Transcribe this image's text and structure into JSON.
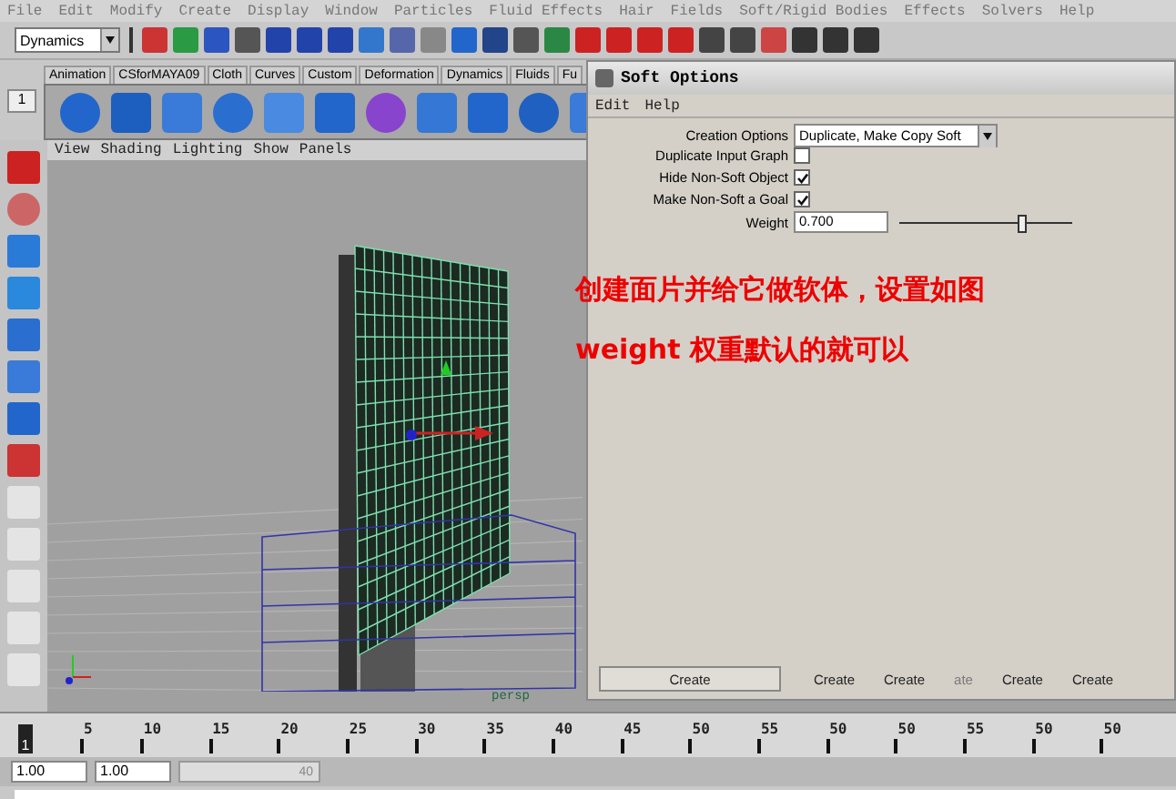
{
  "menu_bar": [
    "File",
    "Edit",
    "Modify",
    "Create",
    "Display",
    "Window",
    "Particles",
    "Fluid Effects",
    "Hair",
    "Fields",
    "Soft/Rigid Bodies",
    "Effects",
    "Solvers",
    "Help"
  ],
  "status_line": {
    "mode": "Dynamics"
  },
  "shelf": {
    "row_number": "1",
    "tabs": [
      "Animation",
      "CSforMAYA09",
      "Cloth",
      "Curves",
      "Custom",
      "Deformation",
      "Dynamics",
      "Fluids",
      "Fu"
    ]
  },
  "viewport": {
    "menu": [
      "View",
      "Shading",
      "Lighting",
      "Show",
      "Panels"
    ],
    "camera_label": "persp"
  },
  "annotation": [
    "创建面片并给它做软体，设置如图",
    "weight 权重默认的就可以"
  ],
  "soft_options": {
    "title": "Soft Options",
    "menu": [
      "Edit",
      "Help"
    ],
    "creation_options": {
      "label": "Creation Options",
      "value": "Duplicate, Make Copy Soft"
    },
    "checkboxes": [
      {
        "label": "Duplicate Input Graph",
        "checked": false
      },
      {
        "label": "Hide Non-Soft Object",
        "checked": true
      },
      {
        "label": "Make Non-Soft a Goal",
        "checked": true
      }
    ],
    "weight": {
      "label": "Weight",
      "value": "0.700",
      "level": 0.68
    },
    "buttons": [
      {
        "label": "Create",
        "kind": "wide"
      },
      {
        "label": "Create",
        "kind": "flat"
      },
      {
        "label": "Create",
        "kind": "flat"
      },
      {
        "label": "ate",
        "kind": "faded"
      },
      {
        "label": "Create",
        "kind": "flat"
      },
      {
        "label": "Create",
        "kind": "flat"
      }
    ]
  },
  "time_slider": {
    "current_frame": "1",
    "ticks": [
      "5",
      "10",
      "15",
      "20",
      "25",
      "30",
      "35",
      "40",
      "45",
      "50",
      "55",
      "50",
      "50",
      "55",
      "50",
      "50"
    ]
  },
  "range_slider": {
    "start": "1.00",
    "end": "1.00",
    "handle_label": "40",
    "level": 1
  }
}
